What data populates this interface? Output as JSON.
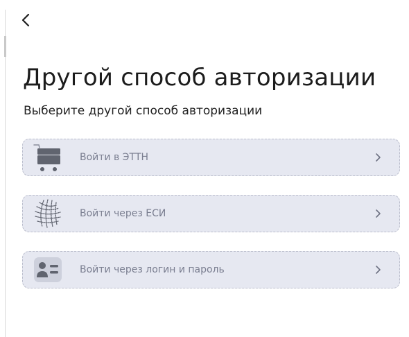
{
  "header": {
    "back_icon": "chevron-left-icon"
  },
  "page": {
    "title": "Другой способ авторизации",
    "subtitle": "Выберите другой способ авторизации"
  },
  "options": [
    {
      "label": "Войти в ЭТТН",
      "icon": "cart-icon"
    },
    {
      "label": "Войти через ЕСИ",
      "icon": "globe-dots-icon"
    },
    {
      "label": "Войти через логин и пароль",
      "icon": "id-card-icon"
    }
  ],
  "colors": {
    "card_background": "#e6e8f1",
    "card_border": "#b9bccb",
    "label_text": "#7a7e90",
    "icon": "#60646f"
  }
}
